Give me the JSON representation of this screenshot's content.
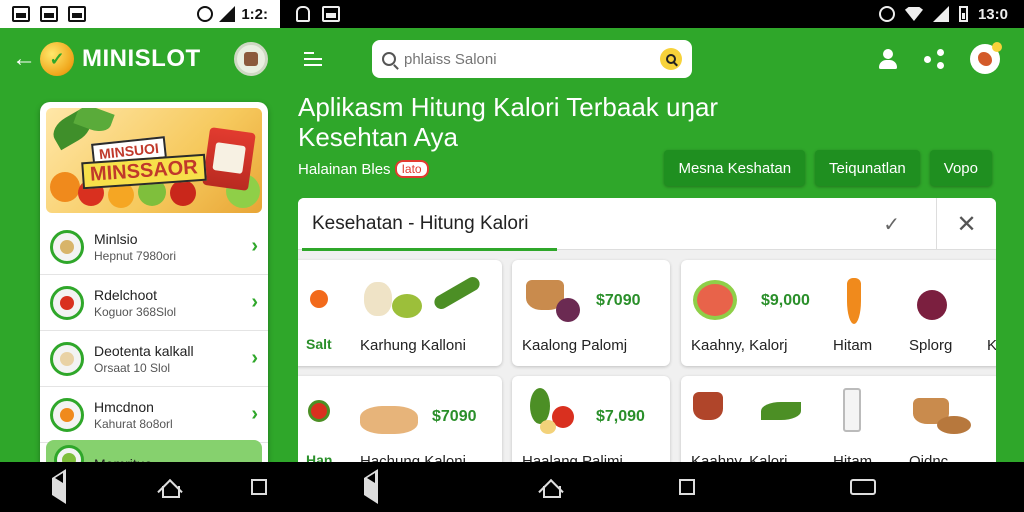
{
  "left_status": {
    "time": "1:2:"
  },
  "right_status": {
    "time": "13:0"
  },
  "left_header": {
    "app_name": "MINISLOT"
  },
  "banner": {
    "line1": "MINSUOI",
    "line2": "MINSSAOR"
  },
  "menu_list": [
    {
      "title": "Minlsio",
      "subtitle": "Hepnut 7980ori"
    },
    {
      "title": "Rdelchoot",
      "subtitle": "Koguor 368Slol"
    },
    {
      "title": "Deotenta kalkall",
      "subtitle": "Orsaat 10 Slol"
    },
    {
      "title": "Hmcdnon",
      "subtitle": "Kahurat 8o8orl"
    }
  ],
  "menu_active": {
    "title": "Momrituo"
  },
  "search": {
    "placeholder": "phlaiss Saloni"
  },
  "hero": {
    "title": "Aplikasm Hitung Kalori Terbaak uŋar Kesehtan Aya",
    "subtitle": "Halainan Bles",
    "badge": "Iato"
  },
  "pills": [
    "Mesna Keshatan",
    "Teiqunatlan",
    "Vopo"
  ],
  "panel": {
    "tab_title": "Kesehatan - Hitung Kalori"
  },
  "cards_row1": [
    {
      "tag": "Salt",
      "label": "Karhung Kalloni",
      "price": ""
    },
    {
      "tag": "",
      "label": "Kaalong Palomj",
      "price": "$7090"
    },
    {
      "tag": "",
      "label": "Kaahny, Kalorj",
      "price": "$9,000"
    },
    {
      "tag": "",
      "label": "Hitam",
      "price": ""
    },
    {
      "tag": "",
      "label": "Splorg",
      "price": ""
    },
    {
      "tag": "",
      "label": "K",
      "price": ""
    }
  ],
  "cards_row2": [
    {
      "tag": "Han",
      "label": "Hachung Kaloni",
      "price": "$7090"
    },
    {
      "tag": "",
      "label": "Haalang Palimi",
      "price": "$7,090"
    },
    {
      "tag": "",
      "label": "Kaahny, Kalorj",
      "price": ""
    },
    {
      "tag": "",
      "label": "Hitam",
      "price": ""
    },
    {
      "tag": "",
      "label": "Oidnc",
      "price": ""
    }
  ],
  "colors": {
    "brand_green": "#2fa72a",
    "dark_green": "#1f8f20",
    "accent_yellow": "#f7d23a",
    "badge_red": "#e23b2f"
  }
}
